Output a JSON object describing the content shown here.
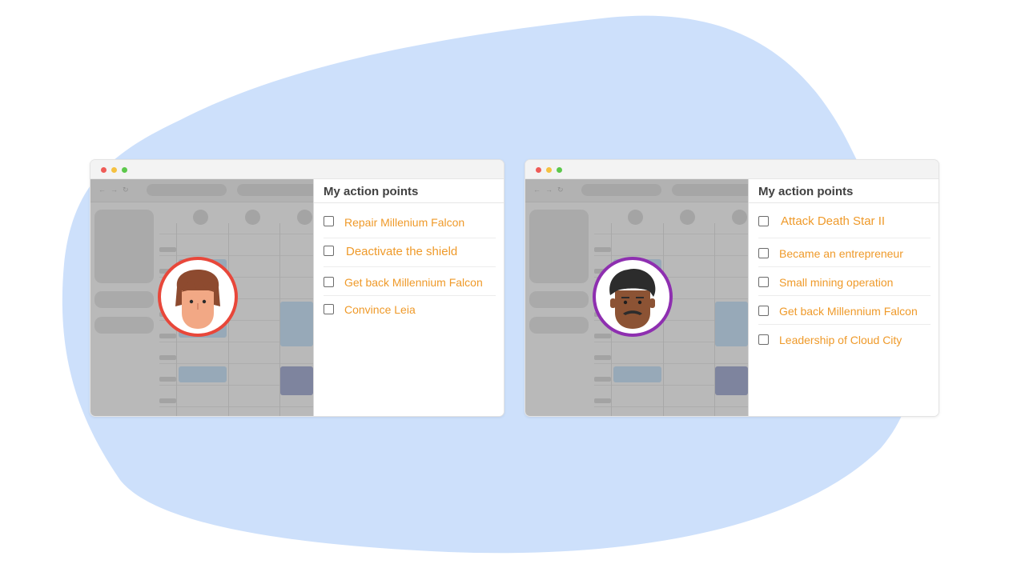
{
  "colors": {
    "background_blob": "#cde0fb",
    "accent_item_text": "#ef9a2a",
    "avatar1_ring": "#e8473a",
    "avatar2_ring": "#8e2fb0"
  },
  "windows": [
    {
      "panel_title": "My action points",
      "avatar_icon": "brown-haired-person-avatar",
      "items": [
        {
          "label": "Repair Millenium Falcon",
          "checked": false
        },
        {
          "label": "Deactivate the shield",
          "checked": false
        },
        {
          "label": "Get back Millennium Falcon",
          "checked": false
        },
        {
          "label": "Convince Leia",
          "checked": false
        }
      ]
    },
    {
      "panel_title": "My action points",
      "avatar_icon": "mustached-person-avatar",
      "items": [
        {
          "label": "Attack Death Star II",
          "checked": false
        },
        {
          "label": "Became an entrepreneur",
          "checked": false
        },
        {
          "label": "Small mining operation",
          "checked": false
        },
        {
          "label": "Get back Millennium Falcon",
          "checked": false
        },
        {
          "label": "Leadership of Cloud City",
          "checked": false
        }
      ]
    }
  ]
}
